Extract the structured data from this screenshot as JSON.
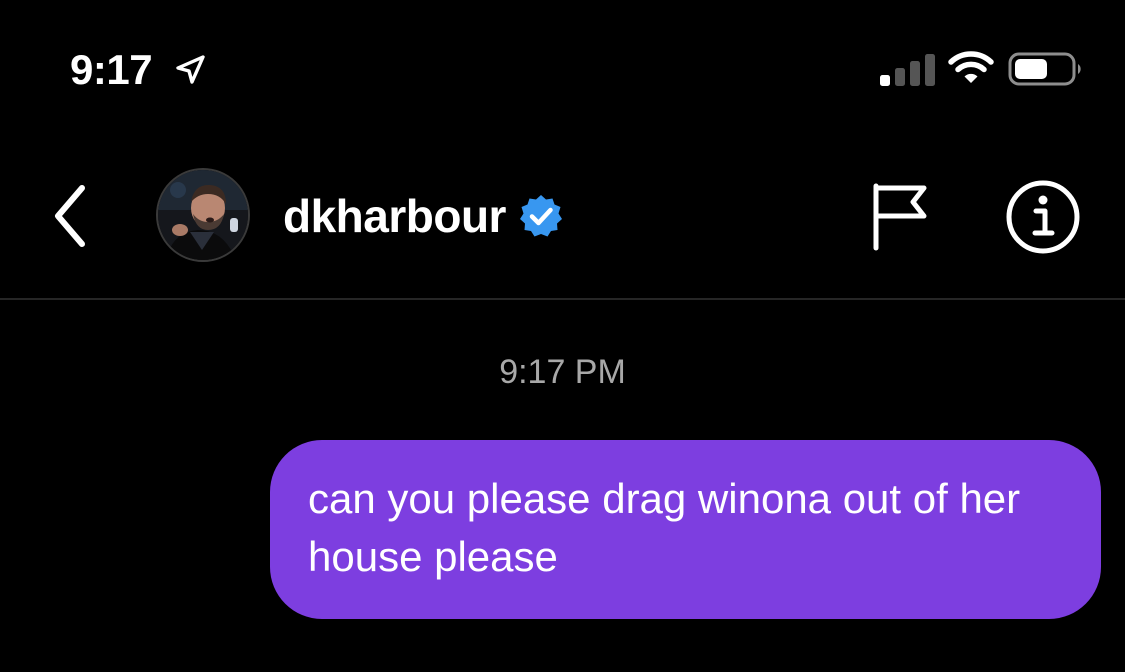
{
  "status_bar": {
    "time": "9:17",
    "icons": [
      "location-arrow-icon",
      "cellular-signal-icon",
      "wifi-icon",
      "battery-icon"
    ]
  },
  "header": {
    "username": "dkharbour",
    "verified": true,
    "icons": [
      "back-chevron-icon",
      "avatar",
      "verified-badge-icon",
      "flag-icon",
      "info-icon"
    ]
  },
  "conversation": {
    "timestamp": "9:17 PM",
    "messages": [
      {
        "sender": "self",
        "text": "can you please drag winona out of her house please"
      }
    ]
  },
  "colors": {
    "background": "#000000",
    "outgoing_bubble": "#7d3ee0",
    "verified_badge": "#3897f0",
    "timestamp_text": "#a8a8a8",
    "divider": "#262626"
  }
}
